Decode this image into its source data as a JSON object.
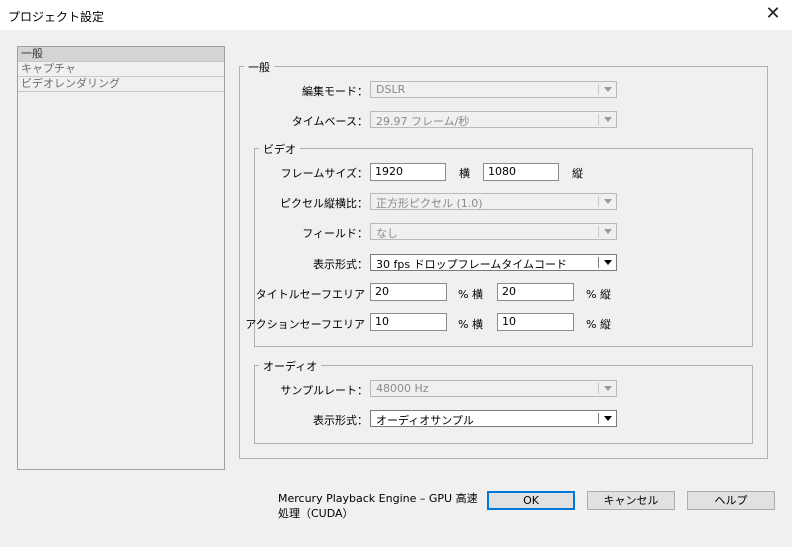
{
  "window": {
    "title": "プロジェクト設定",
    "close_glyph": "✕"
  },
  "categories": [
    "一般",
    "キャプチャ",
    "ビデオレンダリング"
  ],
  "general": {
    "legend": "一般",
    "edit_mode": {
      "label": "編集モード：",
      "value": "DSLR"
    },
    "timebase": {
      "label": "タイムベース：",
      "value": "29.97 フレーム/秒"
    }
  },
  "video": {
    "legend": "ビデオ",
    "frame_size": {
      "label": "フレームサイズ：",
      "width": "1920",
      "width_unit": "横",
      "height": "1080",
      "height_unit": "縦"
    },
    "pixel_aspect": {
      "label": "ピクセル縦横比：",
      "value": "正方形ピクセル (1.0)"
    },
    "fields": {
      "label": "フィールド：",
      "value": "なし"
    },
    "display_format": {
      "label": "表示形式：",
      "value": "30 fps ドロップフレームタイムコード"
    },
    "title_safe": {
      "label": "タイトルセーフエリア",
      "h": "20",
      "h_unit": "% 横",
      "v": "20",
      "v_unit": "% 縦"
    },
    "action_safe": {
      "label": "アクションセーフエリア",
      "h": "10",
      "h_unit": "% 横",
      "v": "10",
      "v_unit": "% 縦"
    }
  },
  "audio": {
    "legend": "オーディオ",
    "sample_rate": {
      "label": "サンプルレート：",
      "value": "48000 Hz"
    },
    "display_format": {
      "label": "表示形式：",
      "value": "オーディオサンプル"
    }
  },
  "footer": {
    "engine_text": "Mercury Playback Engine – GPU 高速処理（CUDA）",
    "ok": "OK",
    "cancel": "キャンセル",
    "help": "ヘルプ"
  }
}
